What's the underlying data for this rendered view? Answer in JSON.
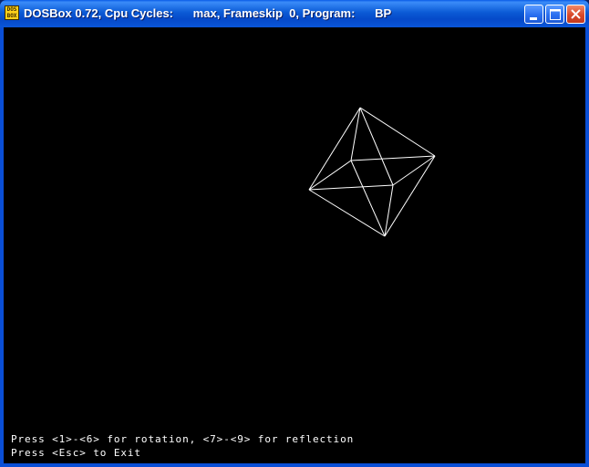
{
  "window": {
    "title": "DOSBox 0.72, Cpu Cycles:      max, Frameskip  0, Program:      BP",
    "app_icon_text": "DOS BOX"
  },
  "caption_buttons": {
    "minimize": "minimize-icon",
    "maximize": "maximize-icon",
    "close": "close-icon"
  },
  "screen": {
    "background": "#000000",
    "foreground": "#ffffff",
    "instructions": [
      "Press <1>-<6> for rotation, <7>-<9> for reflection",
      "Press <Esc> to Exit"
    ]
  }
}
